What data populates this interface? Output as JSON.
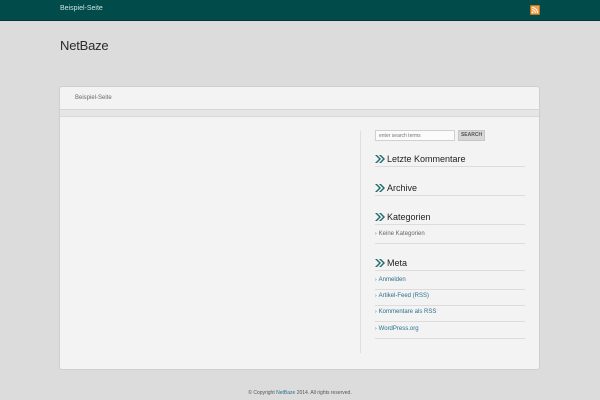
{
  "topbar": {
    "nav_link": "Beispiel-Seite",
    "rss_icon": "rss-icon",
    "accent_color": "#014b4b"
  },
  "site": {
    "title": "NetBaze"
  },
  "panel": {
    "nav_item": "Beispiel-Seite"
  },
  "search": {
    "placeholder": "enter search terms",
    "button": "SEARCH"
  },
  "widgets": {
    "comments": {
      "title": "Letzte Kommentare"
    },
    "archive": {
      "title": "Archive"
    },
    "categories": {
      "title": "Kategorien",
      "items": [
        "Keine Kategorien"
      ]
    },
    "meta": {
      "title": "Meta",
      "items": [
        "Anmelden",
        "Artikel-Feed (RSS)",
        "Kommentare als RSS",
        "WordPress.org"
      ]
    }
  },
  "footer": {
    "prefix": "© Copyright ",
    "brand": "NetBaze",
    "suffix": " 2014. All rights reserved."
  }
}
